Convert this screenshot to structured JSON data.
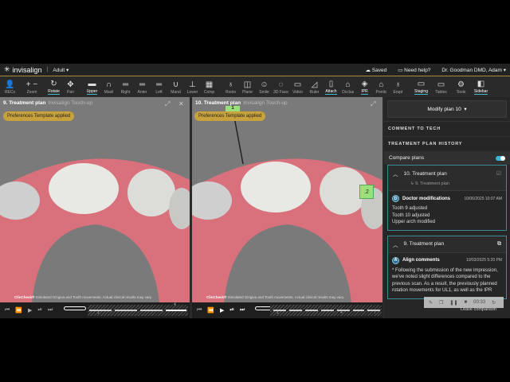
{
  "header": {
    "brand": "invisalign",
    "mode": "Adult",
    "saved": "Saved",
    "help": "Need help?",
    "user": "Dr. Goodman DMD, Adam"
  },
  "toolbar": [
    {
      "label": "RECs",
      "icon": "person-icon"
    },
    {
      "label": "Zoom",
      "icon": "zoom-icon"
    },
    {
      "label": "Rotate",
      "icon": "rotate-icon",
      "active": true
    },
    {
      "label": "Pan",
      "icon": "pan-icon"
    },
    {
      "label": "Upper",
      "icon": "upper-icon",
      "active": true
    },
    {
      "label": "Maxil",
      "icon": "maxil-icon"
    },
    {
      "label": "Right",
      "icon": "right-icon"
    },
    {
      "label": "Anter",
      "icon": "anter-icon"
    },
    {
      "label": "Left",
      "icon": "left-icon"
    },
    {
      "label": "Mand",
      "icon": "mand-icon"
    },
    {
      "label": "Lower",
      "icon": "lower-icon"
    },
    {
      "label": "Comp",
      "icon": "comp-icon"
    },
    {
      "label": "Roots",
      "icon": "tooth-icon"
    },
    {
      "label": "Plane",
      "icon": "plane-icon"
    },
    {
      "label": "Smile",
      "icon": "smile-icon"
    },
    {
      "label": "3D Face",
      "icon": "face-icon"
    },
    {
      "label": "Video",
      "icon": "video-icon"
    },
    {
      "label": "Ruler",
      "icon": "ruler-icon"
    },
    {
      "label": "Attach",
      "icon": "attach-icon",
      "active": true
    },
    {
      "label": "Occlus",
      "icon": "occlus-icon"
    },
    {
      "label": "IPR",
      "icon": "ipr-icon",
      "active": true
    },
    {
      "label": "Pontic",
      "icon": "pontic-icon"
    },
    {
      "label": "Erupt",
      "icon": "erupt-icon"
    },
    {
      "label": "Staging",
      "icon": "folder-icon",
      "active": true
    },
    {
      "label": "Tables",
      "icon": "table-icon"
    },
    {
      "label": "Tools",
      "icon": "gear-icon"
    },
    {
      "label": "Sidebar",
      "icon": "sidebar-icon",
      "active": true
    }
  ],
  "left_view": {
    "title": "9. Treatment plan",
    "subtitle": "Invisalign Touch-up",
    "badge": "Preferences Template applied",
    "disclaimer_brand": "ClinCheck®",
    "disclaimer": "Simulated Gingiva and Tooth movements. Actual clinical results may vary.",
    "stage_labels": [
      "1",
      "4"
    ]
  },
  "right_view": {
    "title": "10. Treatment plan",
    "subtitle": "Invisalign Touch-up",
    "badge": "Preferences Template applied",
    "marker1": "1",
    "marker2": ".2",
    "disclaimer_brand": "ClinCheck®",
    "disclaimer": "Simulated Gingiva and Tooth movements. Actual clinical results may vary.",
    "stage_labels": [
      "1",
      "4",
      "7"
    ]
  },
  "sidebar": {
    "modify": "Modify plan 10",
    "comment_to_tech": "COMMENT TO TECH",
    "history": "TREATMENT PLAN HISTORY",
    "compare": "Compare plans",
    "compare_on": true,
    "plan10": {
      "title": "10. Treatment plan",
      "sub": "9. Treatment plan",
      "author": "Doctor modifications",
      "avatar": "D",
      "date": "10/06/2025 10:07 AM",
      "lines": [
        "Tooth 9 adjusted",
        "Tooth 10 adjusted",
        "Upper arch modified"
      ]
    },
    "plan9": {
      "title": "9. Treatment plan",
      "author": "Align comments",
      "avatar": "A",
      "date": "10/03/2025 5:20 PM",
      "text": "* Following the submission of the new impression, we've noted slight differences compared to the previous scan. As a result, the previously planned rotation movements for UL1, as well as the IPR"
    }
  },
  "recording": {
    "time": "00:33",
    "leave": "Leave comparison"
  },
  "colors": {
    "accent": "#39b6d6",
    "badge": "#c7a23c",
    "gum": "#d9717d",
    "marker": "#9be07a"
  }
}
